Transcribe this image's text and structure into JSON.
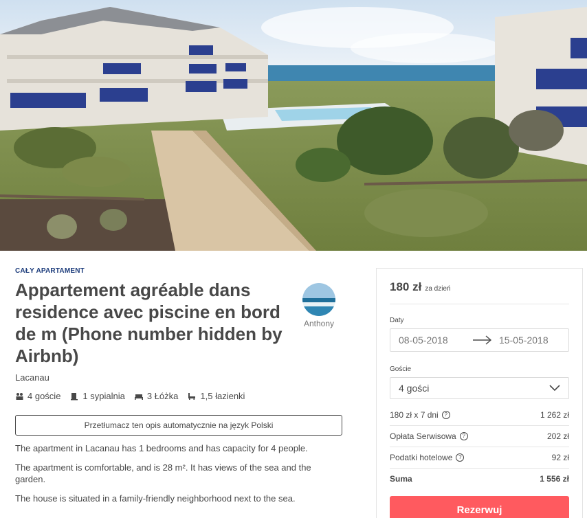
{
  "listing": {
    "type_label": "CAŁY APARTAMENT",
    "title": "Appartement agréable dans residence avec piscine en bord de m (Phone number hidden by Airbnb)",
    "location": "Lacanau",
    "host_name": "Anthony",
    "amenities": [
      {
        "icon": "guests-icon",
        "label": "4 goście"
      },
      {
        "icon": "bedroom-icon",
        "label": "1 sypialnia"
      },
      {
        "icon": "bed-icon",
        "label": "3 Łóżka"
      },
      {
        "icon": "bath-icon",
        "label": "1,5 łazienki"
      }
    ],
    "translate_label": "Przetłumacz ten opis automatycznie na język Polski",
    "description": [
      "The apartment in Lacanau has 1 bedrooms and has capacity for 4 people.",
      "The apartment is comfortable, and is 28 m². It has views of the sea and the garden.",
      "The house is situated in a family-friendly neighborhood next to the sea."
    ]
  },
  "booking": {
    "price": "180 zł",
    "price_unit": "za dzień",
    "dates_label": "Daty",
    "check_in": "08-05-2018",
    "check_out": "15-05-2018",
    "guests_label": "Goście",
    "guests_value": "4 gości",
    "breakdown": [
      {
        "label": "180 zł x 7 dni",
        "value": "1 262 zł",
        "help": true
      },
      {
        "label": "Opłata Serwisowa",
        "value": "202 zł",
        "help": true
      },
      {
        "label": "Podatki hotelowe",
        "value": "92 zł",
        "help": true
      }
    ],
    "total_label": "Suma",
    "total_value": "1 556 zł",
    "reserve_label": "Rezerwuj"
  },
  "colors": {
    "accent": "#ff5a5f",
    "type_label": "#1a3a7a",
    "text": "#484848"
  }
}
